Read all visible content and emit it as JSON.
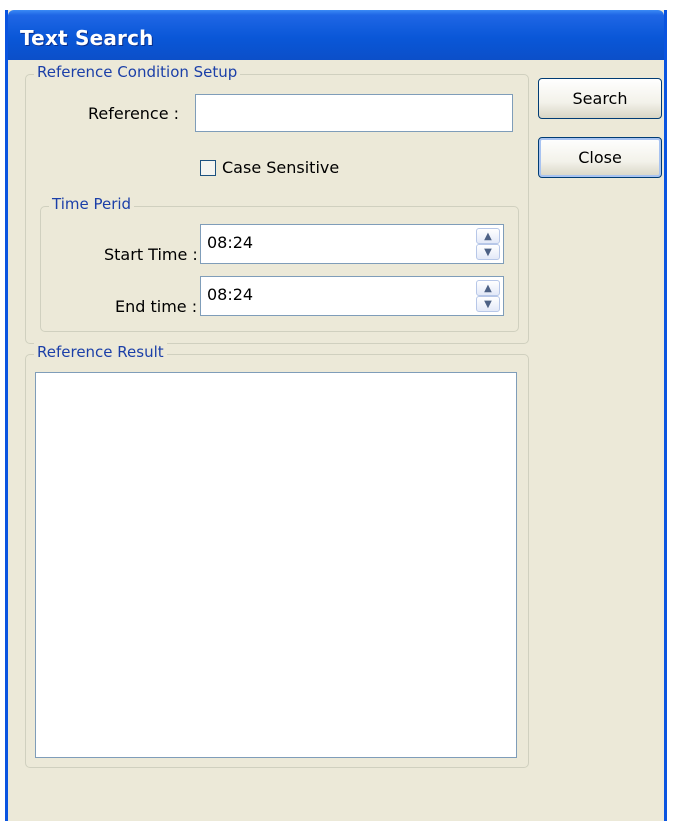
{
  "window": {
    "title": "Text Search"
  },
  "condition_group": {
    "legend": "Reference Condition Setup",
    "reference_label": "Reference :",
    "reference_value": "",
    "case_sensitive_label": "Case Sensitive",
    "case_sensitive_checked": false
  },
  "time_group": {
    "legend": "Time Perid",
    "start_label": "Start Time :",
    "start_value": "08:24",
    "end_label": "End time :",
    "end_value": "08:24"
  },
  "result_group": {
    "legend": "Reference Result",
    "items": []
  },
  "buttons": {
    "search": "Search",
    "close": "Close"
  },
  "icons": {
    "spin_up": "spin-up-arrow",
    "spin_down": "spin-down-arrow"
  },
  "colors": {
    "titlebar": "#0A57D8",
    "window_bg": "#ECE9D8",
    "legend_text": "#1B3FA8"
  }
}
